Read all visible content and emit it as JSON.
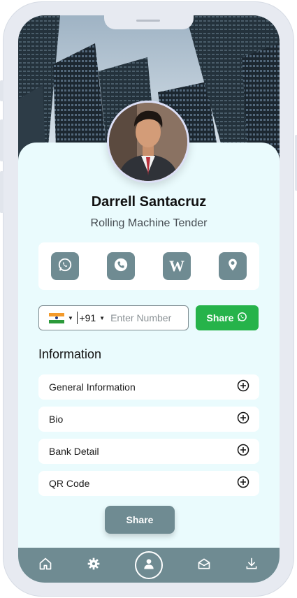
{
  "profile": {
    "name": "Darrell Santacruz",
    "title": "Rolling Machine Tender"
  },
  "social": [
    {
      "icon": "whatsapp-icon"
    },
    {
      "icon": "phone-icon"
    },
    {
      "icon": "wikipedia-icon"
    },
    {
      "icon": "location-pin-icon"
    }
  ],
  "share_form": {
    "country_code": "+91",
    "number_value": "",
    "number_placeholder": "Enter Number",
    "share_label": "Share"
  },
  "information": {
    "heading": "Information",
    "items": [
      {
        "label": "General Information"
      },
      {
        "label": "Bio"
      },
      {
        "label": "Bank Detail"
      },
      {
        "label": "QR Code"
      }
    ]
  },
  "share_button_label": "Share",
  "bottom_nav": [
    "home-icon",
    "settings-gear-icon",
    "profile-icon",
    "mail-open-icon",
    "download-icon"
  ],
  "colors": {
    "accent": "#6f8b92",
    "whatsapp_green": "#26b34a",
    "background": "#eafbfd"
  }
}
